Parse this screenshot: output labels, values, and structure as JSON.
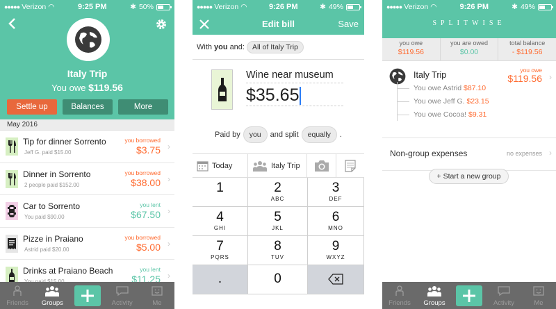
{
  "colors": {
    "brand": "#5bc5a7",
    "orange": "#ff6a2f",
    "settle": "#e8683c",
    "tabbar": "#6a6a6a"
  },
  "screen1": {
    "status": {
      "carrier": "Verizon",
      "time": "9:25 PM",
      "battery": "50%"
    },
    "group_name": "Italy Trip",
    "owe_prefix": "You owe",
    "owe_amount": "$119.56",
    "buttons": {
      "settle": "Settle up",
      "balances": "Balances",
      "more": "More"
    },
    "section": "May 2016",
    "expenses": [
      {
        "icon": "fork-knife-icon",
        "title": "Tip for dinner Sorrento",
        "sub": "Jeff G. paid $15.00",
        "label": "you borrowed",
        "amount": "$3.75",
        "kind": "borrowed"
      },
      {
        "icon": "fork-knife-icon",
        "title": "Dinner in Sorrento",
        "sub": "2 people paid $152.00",
        "label": "you borrowed",
        "amount": "$38.00",
        "kind": "borrowed"
      },
      {
        "icon": "car-icon",
        "title": "Car to Sorrento",
        "sub": "You paid $90.00",
        "label": "you lent",
        "amount": "$67.50",
        "kind": "lent"
      },
      {
        "icon": "receipt-icon",
        "title": "Pizze in Praiano",
        "sub": "Astrid paid $20.00",
        "label": "you borrowed",
        "amount": "$5.00",
        "kind": "borrowed"
      },
      {
        "icon": "bottle-icon",
        "title": "Drinks at Praiano Beach",
        "sub": "You paid $15.00",
        "label": "you lent",
        "amount": "$11.25",
        "kind": "lent"
      }
    ],
    "tabs": {
      "friends": "Friends",
      "groups": "Groups",
      "activity": "Activity",
      "me": "Me"
    }
  },
  "screen2": {
    "status": {
      "carrier": "Verizon",
      "time": "9:26 PM",
      "battery": "49%"
    },
    "title": "Edit bill",
    "save": "Save",
    "with_prefix": "With ",
    "with_you": "you",
    "with_and": " and:",
    "with_group": "All of Italy Trip",
    "description": "Wine near museum",
    "currency": "$",
    "amount": "35.65",
    "paid_by": "Paid by",
    "payer": "you",
    "and_split": "and split",
    "split": "equally",
    "period": ".",
    "date": "Today",
    "group": "Italy Trip",
    "keys": [
      {
        "num": "1",
        "letters": ""
      },
      {
        "num": "2",
        "letters": "ABC"
      },
      {
        "num": "3",
        "letters": "DEF"
      },
      {
        "num": "4",
        "letters": "GHI"
      },
      {
        "num": "5",
        "letters": "JKL"
      },
      {
        "num": "6",
        "letters": "MNO"
      },
      {
        "num": "7",
        "letters": "PQRS"
      },
      {
        "num": "8",
        "letters": "TUV"
      },
      {
        "num": "9",
        "letters": "WXYZ"
      },
      {
        "num": ".",
        "letters": ""
      },
      {
        "num": "0",
        "letters": ""
      }
    ]
  },
  "screen3": {
    "status": {
      "carrier": "Verizon",
      "time": "9:26 PM",
      "battery": "49%"
    },
    "brand": "SPLITWISE",
    "balances": [
      {
        "label": "you owe",
        "value": "$119.56",
        "kind": "orange"
      },
      {
        "label": "you are owed",
        "value": "$0.00",
        "kind": "green"
      },
      {
        "label": "total balance",
        "value": "- $119.56",
        "kind": "orange"
      }
    ],
    "group_name": "Italy Trip",
    "group_label": "you owe",
    "group_amount": "$119.56",
    "debts": [
      {
        "text": "You owe Astrid ",
        "amount": "$87.10"
      },
      {
        "text": "You owe Jeff G. ",
        "amount": "$23.15"
      },
      {
        "text": "You owe Cocoa! ",
        "amount": "$9.31"
      }
    ],
    "nongroup_label": "Non-group expenses",
    "nongroup_value": "no expenses",
    "new_group": "+ Start a new group",
    "tabs": {
      "friends": "Friends",
      "groups": "Groups",
      "activity": "Activity",
      "me": "Me"
    }
  }
}
